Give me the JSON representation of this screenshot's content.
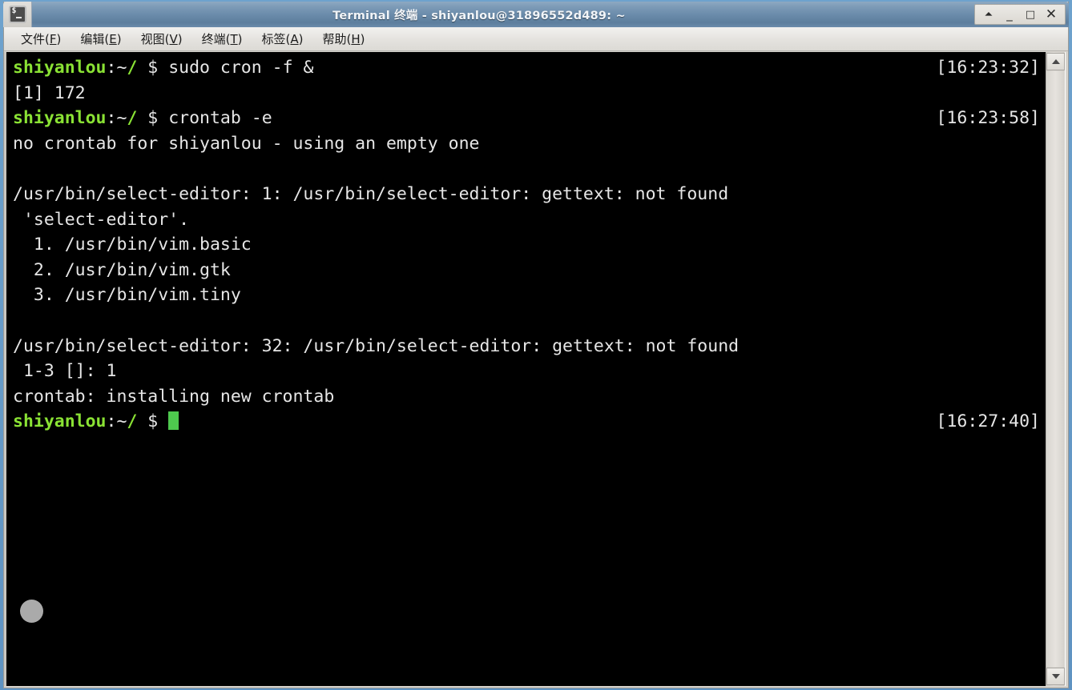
{
  "window": {
    "title": "Terminal 终端 - shiyanlou@31896552d489: ~",
    "icon": "terminal-icon",
    "controls": {
      "shade": "⏶",
      "minimize": "_",
      "maximize": "□",
      "close": "✕"
    }
  },
  "menubar": {
    "items": [
      {
        "label": "文件",
        "accel": "F"
      },
      {
        "label": "编辑",
        "accel": "E"
      },
      {
        "label": "视图",
        "accel": "V"
      },
      {
        "label": "终端",
        "accel": "T"
      },
      {
        "label": "标签",
        "accel": "A"
      },
      {
        "label": "帮助",
        "accel": "H"
      }
    ]
  },
  "terminal": {
    "prompt": {
      "user_host": "shiyanlou",
      "colon": ":",
      "path_tilde": "~",
      "path_slash": "/",
      "symbol": "$"
    },
    "lines": [
      {
        "type": "prompt",
        "command": " sudo cron -f &",
        "timestamp": "[16:23:32]"
      },
      {
        "type": "output",
        "text": "[1] 172"
      },
      {
        "type": "prompt",
        "command": " crontab -e",
        "timestamp": "[16:23:58]"
      },
      {
        "type": "output",
        "text": "no crontab for shiyanlou - using an empty one"
      },
      {
        "type": "output",
        "text": ""
      },
      {
        "type": "output",
        "text": "/usr/bin/select-editor: 1: /usr/bin/select-editor: gettext: not found"
      },
      {
        "type": "output",
        "text": " 'select-editor'."
      },
      {
        "type": "output",
        "text": "  1. /usr/bin/vim.basic"
      },
      {
        "type": "output",
        "text": "  2. /usr/bin/vim.gtk"
      },
      {
        "type": "output",
        "text": "  3. /usr/bin/vim.tiny"
      },
      {
        "type": "output",
        "text": ""
      },
      {
        "type": "output",
        "text": "/usr/bin/select-editor: 32: /usr/bin/select-editor: gettext: not found"
      },
      {
        "type": "output",
        "text": " 1-3 []: 1"
      },
      {
        "type": "output",
        "text": "crontab: installing new crontab"
      },
      {
        "type": "prompt",
        "command": " ",
        "timestamp": "[16:27:40]",
        "cursor": true
      }
    ]
  },
  "scrollbar": {
    "up_arrow": "scroll-up-arrow",
    "down_arrow": "scroll-down-arrow"
  },
  "colors": {
    "terminal_bg": "#000000",
    "terminal_fg": "#d8d8d8",
    "prompt_green": "#8ae234",
    "cursor_green": "#4ec94e",
    "titlebar_blue": "#6b8cab",
    "desktop_blue": "#5a8fc0"
  }
}
